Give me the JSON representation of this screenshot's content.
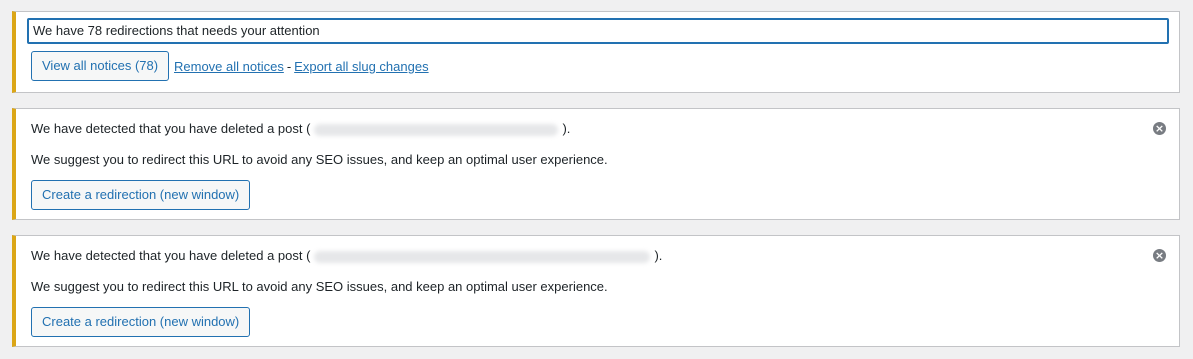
{
  "summary_notice": {
    "message": "We have 78 redirections that needs your attention",
    "view_all_label": "View all notices (78)",
    "remove_all_label": "Remove all notices",
    "separator": "-",
    "export_label": "Export all slug changes"
  },
  "deleted_notices": [
    {
      "prefix": "We have detected that you have deleted a post (",
      "suffix": ").",
      "suggestion": "We suggest you to redirect this URL to avoid any SEO issues, and keep an optimal user experience.",
      "button_label": "Create a redirection (new window)",
      "dismiss_icon": "close-circle-icon"
    },
    {
      "prefix": "We have detected that you have deleted a post (",
      "suffix": ").",
      "suggestion": "We suggest you to redirect this URL to avoid any SEO issues, and keep an optimal user experience.",
      "button_label": "Create a redirection (new window)",
      "dismiss_icon": "close-circle-icon"
    }
  ],
  "colors": {
    "accent_border": "#dba617",
    "link": "#2271b1",
    "background": "#f0f0f1"
  }
}
